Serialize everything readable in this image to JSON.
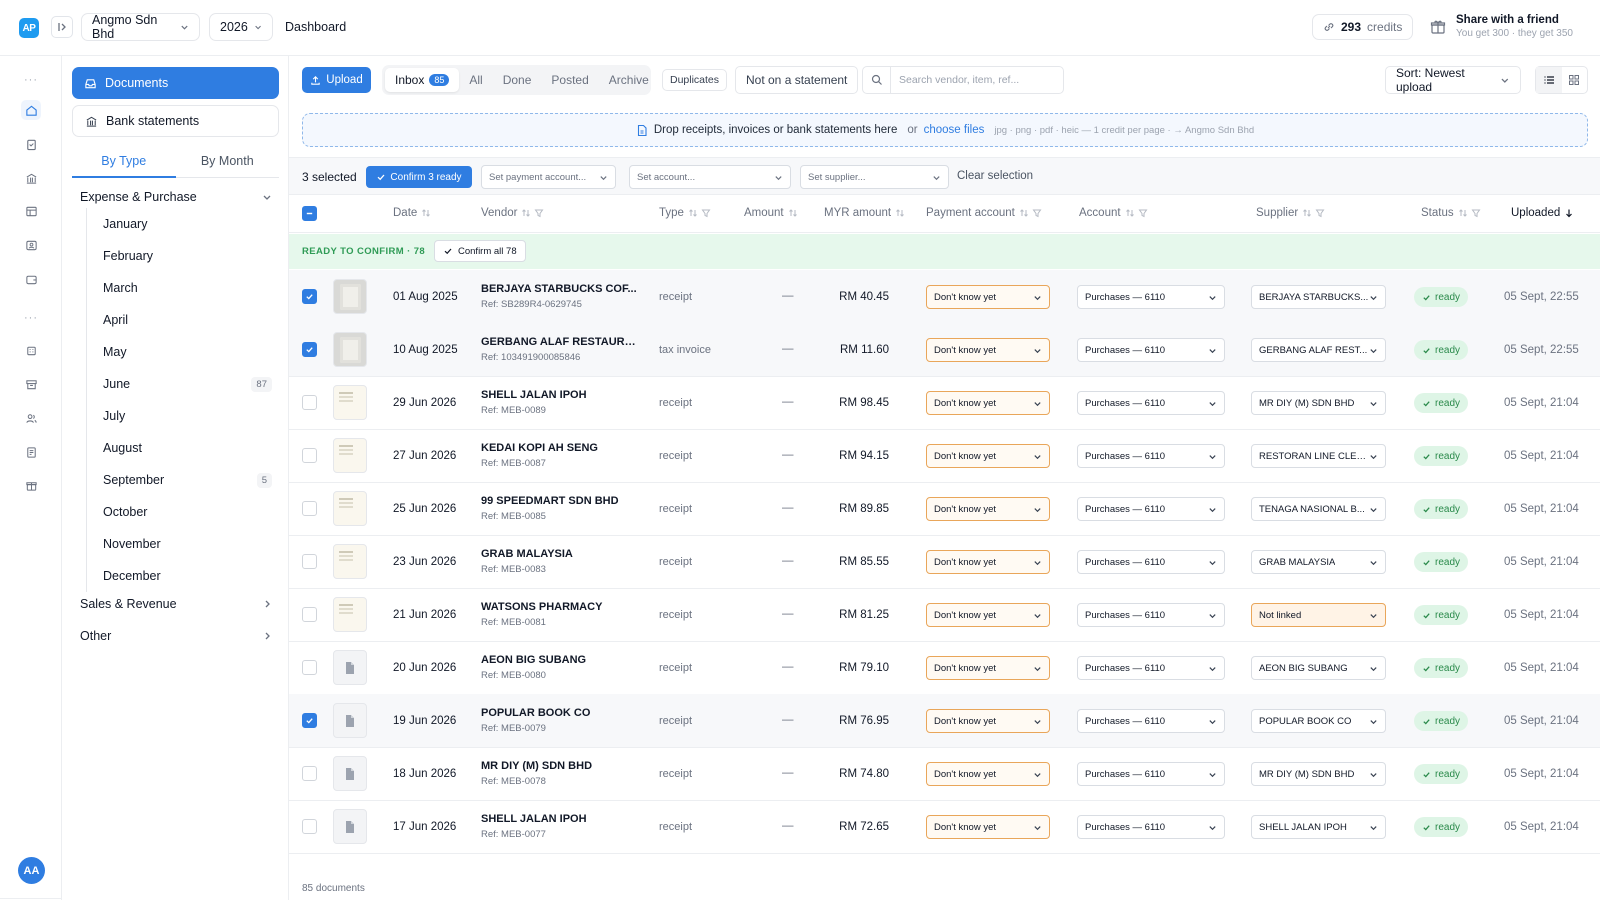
{
  "topbar": {
    "logo": "AP",
    "company": "Angmo Sdn Bhd",
    "year": "2026",
    "breadcrumb": "Dashboard",
    "credits_count": "293",
    "credits_label": "credits",
    "share_title": "Share with a friend",
    "share_sub": "You get 300 · they get 350"
  },
  "user": {
    "initials": "AA"
  },
  "sidebar": {
    "documents": "Documents",
    "bank_statements": "Bank statements",
    "tabs": [
      "By Type",
      "By Month"
    ],
    "group_expense": "Expense & Purchase",
    "months": [
      {
        "name": "January",
        "count": ""
      },
      {
        "name": "February",
        "count": ""
      },
      {
        "name": "March",
        "count": ""
      },
      {
        "name": "April",
        "count": ""
      },
      {
        "name": "May",
        "count": ""
      },
      {
        "name": "June",
        "count": "87"
      },
      {
        "name": "July",
        "count": ""
      },
      {
        "name": "August",
        "count": ""
      },
      {
        "name": "September",
        "count": "5"
      },
      {
        "name": "October",
        "count": ""
      },
      {
        "name": "November",
        "count": ""
      },
      {
        "name": "December",
        "count": ""
      }
    ],
    "group_sales": "Sales & Revenue",
    "group_other": "Other"
  },
  "toolbar": {
    "upload": "Upload",
    "tabs": [
      "Inbox",
      "All",
      "Done",
      "Posted",
      "Archive"
    ],
    "inbox_count": "85",
    "duplicates": "Duplicates",
    "not_on_statement": "Not on a statement",
    "search_placeholder": "Search vendor, item, ref...",
    "sort": "Sort: Newest upload"
  },
  "dropzone": {
    "text": "Drop receipts, invoices or bank statements here",
    "or": "or",
    "link": "choose files",
    "hint": "jpg · png · pdf · heic — 1 credit per page · → Angmo Sdn Bhd"
  },
  "selection": {
    "count_label": "3 selected",
    "confirm": "Confirm 3 ready",
    "payment_placeholder": "Set payment account...",
    "account_placeholder": "Set account...",
    "supplier_placeholder": "Set supplier...",
    "clear": "Clear selection"
  },
  "table": {
    "headers": {
      "date": "Date",
      "vendor": "Vendor",
      "type": "Type",
      "amount": "Amount",
      "myr": "MYR amount",
      "payment": "Payment account",
      "account": "Account",
      "supplier": "Supplier",
      "status": "Status",
      "uploaded": "Uploaded"
    },
    "ready_label": "READY TO CONFIRM · 78",
    "confirm_all": "Confirm all 78",
    "rows": [
      {
        "checked": true,
        "thumb": "photo",
        "date": "01 Aug 2025",
        "vendor": "BERJAYA STARBUCKS COF...",
        "ref": "Ref: SB289R4-0629745",
        "type": "receipt",
        "amount": "—",
        "myr": "RM 40.45",
        "payment": "Don't know yet",
        "account": "Purchases — 6110",
        "supplier": "BERJAYA STARBUCKS...",
        "supplier_warn": false,
        "status": "ready",
        "uploaded": "05 Sept, 22:55"
      },
      {
        "checked": true,
        "thumb": "photo",
        "date": "10 Aug 2025",
        "vendor": "GERBANG ALAF RESTAURA...",
        "ref": "Ref: 103491900085846",
        "type": "tax invoice",
        "amount": "—",
        "myr": "RM 11.60",
        "payment": "Don't know yet",
        "account": "Purchases — 6110",
        "supplier": "GERBANG ALAF REST...",
        "supplier_warn": false,
        "status": "ready",
        "uploaded": "05 Sept, 22:55"
      },
      {
        "checked": false,
        "thumb": "doc",
        "date": "29 Jun 2026",
        "vendor": "SHELL JALAN IPOH",
        "ref": "Ref: MEB-0089",
        "type": "receipt",
        "amount": "—",
        "myr": "RM 98.45",
        "payment": "Don't know yet",
        "account": "Purchases — 6110",
        "supplier": "MR DIY (M) SDN BHD",
        "supplier_warn": false,
        "status": "ready",
        "uploaded": "05 Sept, 21:04"
      },
      {
        "checked": false,
        "thumb": "doc",
        "date": "27 Jun 2026",
        "vendor": "KEDAI KOPI AH SENG",
        "ref": "Ref: MEB-0087",
        "type": "receipt",
        "amount": "—",
        "myr": "RM 94.15",
        "payment": "Don't know yet",
        "account": "Purchases — 6110",
        "supplier": "RESTORAN LINE CLEAR",
        "supplier_warn": false,
        "status": "ready",
        "uploaded": "05 Sept, 21:04"
      },
      {
        "checked": false,
        "thumb": "doc",
        "date": "25 Jun 2026",
        "vendor": "99 SPEEDMART SDN BHD",
        "ref": "Ref: MEB-0085",
        "type": "receipt",
        "amount": "—",
        "myr": "RM 89.85",
        "payment": "Don't know yet",
        "account": "Purchases — 6110",
        "supplier": "TENAGA NASIONAL B...",
        "supplier_warn": false,
        "status": "ready",
        "uploaded": "05 Sept, 21:04"
      },
      {
        "checked": false,
        "thumb": "doc",
        "date": "23 Jun 2026",
        "vendor": "GRAB MALAYSIA",
        "ref": "Ref: MEB-0083",
        "type": "receipt",
        "amount": "—",
        "myr": "RM 85.55",
        "payment": "Don't know yet",
        "account": "Purchases — 6110",
        "supplier": "GRAB MALAYSIA",
        "supplier_warn": false,
        "status": "ready",
        "uploaded": "05 Sept, 21:04"
      },
      {
        "checked": false,
        "thumb": "doc",
        "date": "21 Jun 2026",
        "vendor": "WATSONS PHARMACY",
        "ref": "Ref: MEB-0081",
        "type": "receipt",
        "amount": "—",
        "myr": "RM 81.25",
        "payment": "Don't know yet",
        "account": "Purchases — 6110",
        "supplier": "Not linked",
        "supplier_warn": true,
        "status": "ready",
        "uploaded": "05 Sept, 21:04"
      },
      {
        "checked": false,
        "thumb": "file",
        "date": "20 Jun 2026",
        "vendor": "AEON BIG SUBANG",
        "ref": "Ref: MEB-0080",
        "type": "receipt",
        "amount": "—",
        "myr": "RM 79.10",
        "payment": "Don't know yet",
        "account": "Purchases — 6110",
        "supplier": "AEON BIG SUBANG",
        "supplier_warn": false,
        "status": "ready",
        "uploaded": "05 Sept, 21:04"
      },
      {
        "checked": true,
        "thumb": "file",
        "date": "19 Jun 2026",
        "vendor": "POPULAR BOOK CO",
        "ref": "Ref: MEB-0079",
        "type": "receipt",
        "amount": "—",
        "myr": "RM 76.95",
        "payment": "Don't know yet",
        "account": "Purchases — 6110",
        "supplier": "POPULAR BOOK CO",
        "supplier_warn": false,
        "status": "ready",
        "uploaded": "05 Sept, 21:04"
      },
      {
        "checked": false,
        "thumb": "file",
        "date": "18 Jun 2026",
        "vendor": "MR DIY (M) SDN BHD",
        "ref": "Ref: MEB-0078",
        "type": "receipt",
        "amount": "—",
        "myr": "RM 74.80",
        "payment": "Don't know yet",
        "account": "Purchases — 6110",
        "supplier": "MR DIY (M) SDN BHD",
        "supplier_warn": false,
        "status": "ready",
        "uploaded": "05 Sept, 21:04"
      },
      {
        "checked": false,
        "thumb": "file",
        "date": "17 Jun 2026",
        "vendor": "SHELL JALAN IPOH",
        "ref": "Ref: MEB-0077",
        "type": "receipt",
        "amount": "—",
        "myr": "RM 72.65",
        "payment": "Don't know yet",
        "account": "Purchases — 6110",
        "supplier": "SHELL JALAN IPOH",
        "supplier_warn": false,
        "status": "ready",
        "uploaded": "05 Sept, 21:04"
      }
    ],
    "footer": "85 documents"
  },
  "colors": {
    "accent": "#2f7de1",
    "ready_bg": "#e6f8ec",
    "ready_text": "#2f9b56",
    "warn_border": "#e9a65a"
  }
}
